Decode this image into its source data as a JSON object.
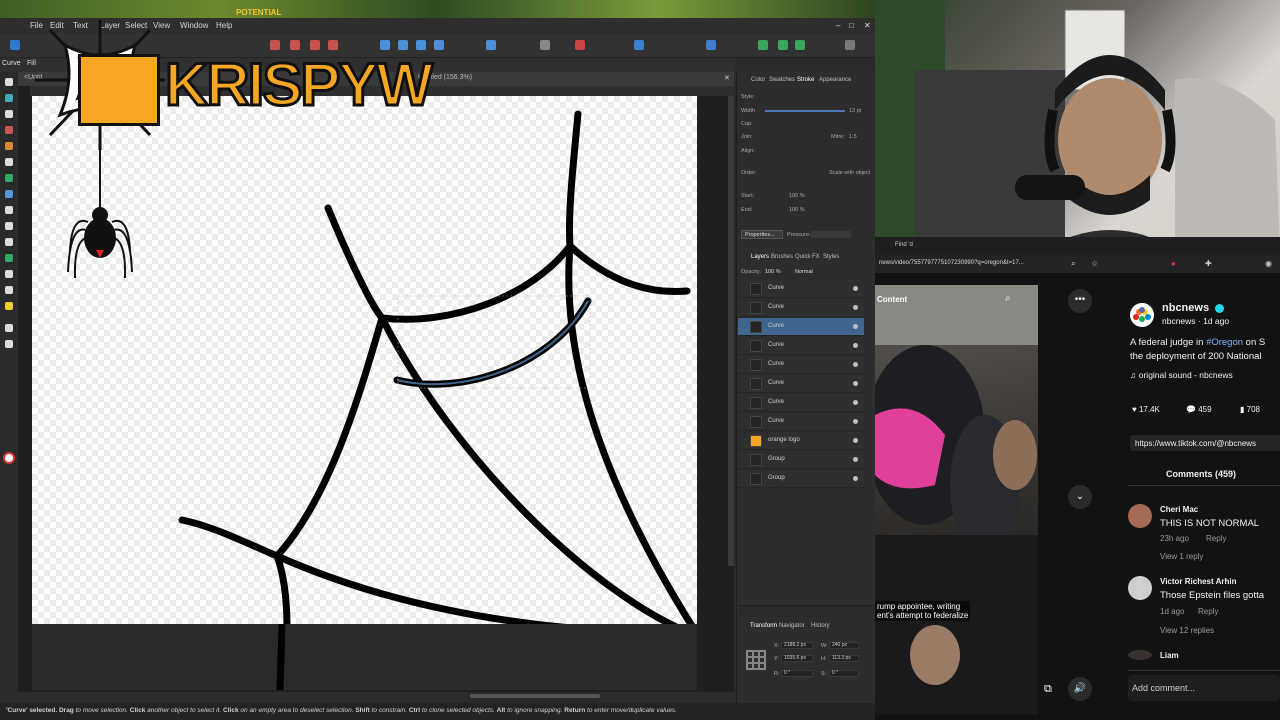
{
  "overlay": {
    "brand_logo_text": "KRISPYW",
    "brand_label": "POTENTIAL"
  },
  "affinity": {
    "menu": [
      "File",
      "Edit",
      "Text",
      "Layer",
      "Select",
      "View",
      "Window",
      "Help"
    ],
    "context_tool_label": "Curve",
    "context_file_label": "Fill",
    "document_tab": "Untitled (156.3%)",
    "document_tab_prefix": "<Untit",
    "status": {
      "t1": "'Curve' selected.",
      "t2": "Drag",
      "t3": "to move selection.",
      "t4": "Click",
      "t5": "another object to select it.",
      "t6": "Click",
      "t7": "on an empty area to deselect selection.",
      "t8": "Shift",
      "t9": "to constrain.",
      "t10": "Ctrl",
      "t11": "to clone selected objects.",
      "t12": "Alt",
      "t13": "to ignore snapping.",
      "t14": "Return",
      "t15": "to enter move/duplicate values."
    },
    "panel_tabs_top": [
      "Color",
      "Swatches",
      "Stroke",
      "Appearance"
    ],
    "stroke": {
      "style_label": "Style:",
      "width_label": "Width",
      "width_value": "13 pt",
      "cap_label": "Cap:",
      "join_label": "Join:",
      "mitre_label": "Mitre:",
      "mitre_value": "1.5",
      "align_label": "Align:",
      "order_label": "Order:",
      "scale_label": "Scale with object",
      "start_label": "Start:",
      "end_label": "End:",
      "start_pct": "100 %",
      "end_pct": "100 %",
      "properties_label": "Properties...",
      "pressure_label": "Pressure:"
    },
    "layers_tabs": [
      "Layers",
      "Brushes",
      "Quick FX",
      "Styles"
    ],
    "opacity_label": "Opacity:",
    "opacity_value": "100 %",
    "blend_mode": "Normal",
    "layers": [
      {
        "name": "Curve",
        "selected": false
      },
      {
        "name": "Curve",
        "selected": false
      },
      {
        "name": "Curve",
        "selected": true
      },
      {
        "name": "Curve",
        "selected": false
      },
      {
        "name": "Curve",
        "selected": false
      },
      {
        "name": "Curve",
        "selected": false
      },
      {
        "name": "Curve",
        "selected": false
      },
      {
        "name": "Curve",
        "selected": false
      },
      {
        "name": "orange logo",
        "selected": false
      },
      {
        "name": "Group",
        "selected": false
      },
      {
        "name": "Group",
        "selected": false
      }
    ],
    "transform_tabs": [
      "Transform",
      "Navigator",
      "History"
    ],
    "transform": {
      "x_label": "X:",
      "x": "2188.2 px",
      "y_label": "Y:",
      "y": "1035.6 px",
      "w_label": "W:",
      "w": "240 px",
      "h_label": "H:",
      "h": "113.3 px",
      "r_label": "R:",
      "r": "0 °",
      "s_label": "S:",
      "s": "0 °"
    }
  },
  "browser": {
    "tab_label": "Find 'd",
    "url": "news/video/7557797775107230990?q=oregon&t=17..."
  },
  "tiktok": {
    "content_label": "Content",
    "video_caption_1": "rump appointee, writing",
    "video_caption_2": "ent's attempt to federalize",
    "author": "nbcnews",
    "author_meta": "nbcnews · 1d ago",
    "description_1": "A federal judge in ",
    "description_hashtag": "#Oregon",
    "description_2": " on S",
    "description_3": "the deployment of 200 National",
    "sound": "original sound - nbcnews",
    "likes": "17.4K",
    "comment_count": "459",
    "saves": "708",
    "link": "https://www.tiktok.com/@nbcnews",
    "comments_header": "Comments (459)",
    "comments": [
      {
        "user": "Cheri Mac",
        "text": "THIS IS NOT NORMAL",
        "time": "23h ago",
        "reply": "Reply",
        "view": "View 1 reply"
      },
      {
        "user": "Victor Richest Arhin",
        "text": "Those Epstein files gotta",
        "time": "1d ago",
        "reply": "Reply",
        "view": "View 12 replies"
      },
      {
        "user": "Liam",
        "text": "",
        "time": "",
        "reply": "",
        "view": ""
      }
    ],
    "add_comment_placeholder": "Add comment..."
  },
  "colors": {
    "accent_blue": "#3f6690",
    "logo_orange": "#f5a623",
    "verified": "#20d5ec"
  }
}
